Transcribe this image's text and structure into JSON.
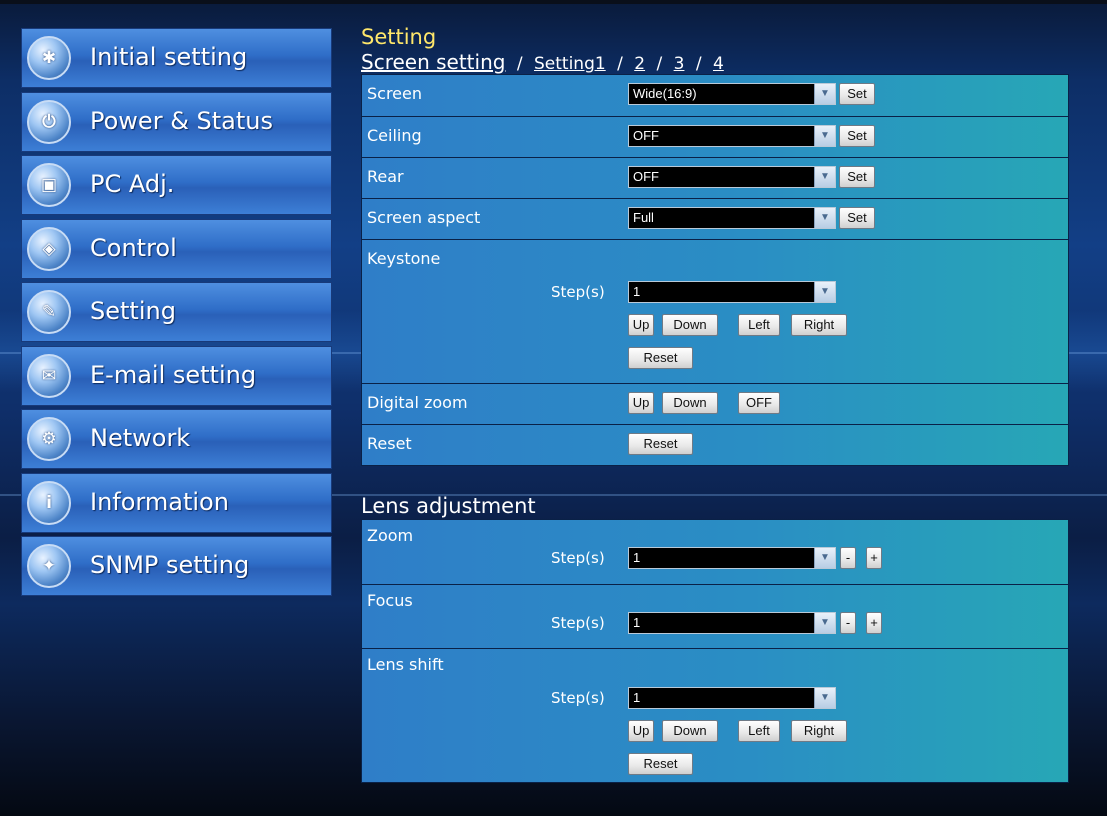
{
  "sidebar": {
    "items": [
      {
        "label": "Initial setting",
        "icon": "wrench-gear-icon"
      },
      {
        "label": "Power & Status",
        "icon": "power-status-icon"
      },
      {
        "label": "PC Adj.",
        "icon": "pc-monitor-icon"
      },
      {
        "label": "Control",
        "icon": "control-dial-icon"
      },
      {
        "label": "Setting",
        "icon": "setting-tools-icon"
      },
      {
        "label": "E-mail setting",
        "icon": "envelope-icon"
      },
      {
        "label": "Network",
        "icon": "network-icon"
      },
      {
        "label": "Information",
        "icon": "information-icon"
      },
      {
        "label": "SNMP setting",
        "icon": "snmp-icon"
      }
    ]
  },
  "main": {
    "section_title": "Setting",
    "breadcrumb": {
      "current": "Screen setting",
      "sep": "/",
      "link1": "Setting1",
      "link2": "2",
      "link3": "3",
      "link4": "4"
    },
    "screen": {
      "label": "Screen",
      "value": "Wide(16:9)",
      "button": "Set"
    },
    "ceiling": {
      "label": "Ceiling",
      "value": "OFF",
      "button": "Set"
    },
    "rear": {
      "label": "Rear",
      "value": "OFF",
      "button": "Set"
    },
    "screen_aspect": {
      "label": "Screen aspect",
      "value": "Full",
      "button": "Set"
    },
    "keystone": {
      "label": "Keystone",
      "step_label": "Step(s)",
      "step_value": "1",
      "up": "Up",
      "down": "Down",
      "left": "Left",
      "right": "Right",
      "reset": "Reset"
    },
    "digital_zoom": {
      "label": "Digital zoom",
      "up": "Up",
      "down": "Down",
      "off": "OFF"
    },
    "reset_row": {
      "label": "Reset",
      "button": "Reset"
    }
  },
  "lens": {
    "title": "Lens adjustment",
    "zoom": {
      "label": "Zoom",
      "step_label": "Step(s)",
      "step_value": "1",
      "minus": "-",
      "plus": "+"
    },
    "focus": {
      "label": "Focus",
      "step_label": "Step(s)",
      "step_value": "1",
      "minus": "-",
      "plus": "+"
    },
    "shift": {
      "label": "Lens shift",
      "step_label": "Step(s)",
      "step_value": "1",
      "up": "Up",
      "down": "Down",
      "left": "Left",
      "right": "Right",
      "reset": "Reset"
    }
  }
}
